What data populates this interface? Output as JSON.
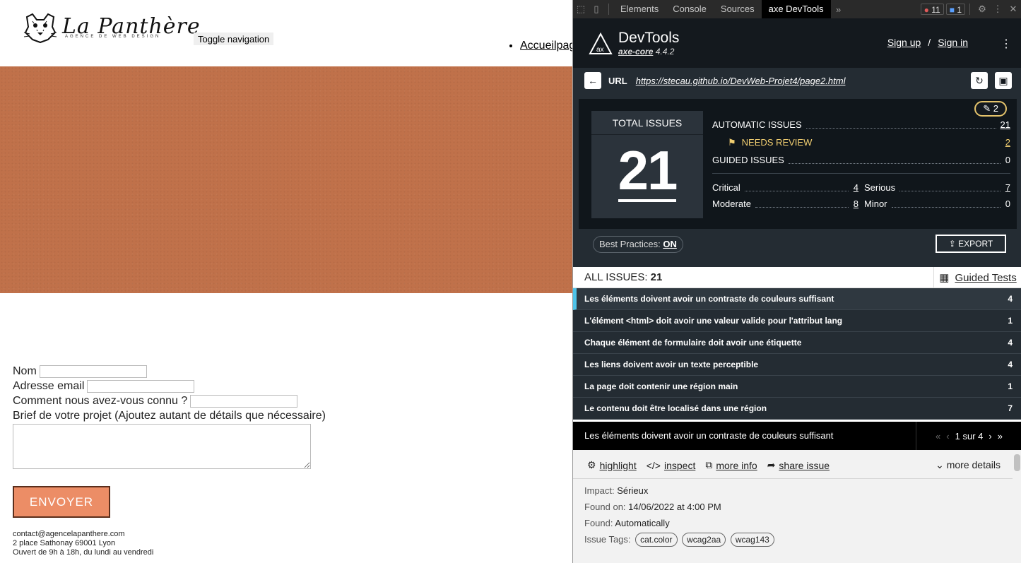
{
  "site": {
    "logo_title": "La Panthère",
    "logo_subtitle": "AGENCE DE WEB DESIGN",
    "toggle_nav": "Toggle navigation",
    "nav_item": "Accueilpag",
    "form": {
      "name_label": "Nom",
      "email_label": "Adresse email",
      "source_label": "Comment nous avez-vous connu ?",
      "brief_label": "Brief de votre projet (Ajoutez autant de détails que nécessaire)",
      "submit": "ENVOYER"
    },
    "footer": {
      "email": "contact@agencelapanthere.com",
      "address": "2 place Sathonay 69001 Lyon",
      "hours": "Ouvert de 9h à 18h, du lundi au vendredi"
    }
  },
  "devtools": {
    "tabs": [
      "Elements",
      "Console",
      "Sources",
      "axe DevTools"
    ],
    "more_tabs": "»",
    "error_count": "11",
    "message_count": "1",
    "axe": {
      "title": "DevTools",
      "core_name": "axe-core",
      "core_version": "4.4.2",
      "sign_up": "Sign up",
      "slash": "/",
      "sign_in": "Sign in",
      "url_label": "URL",
      "url": "https://stecau.github.io/DevWeb-Projet4/page2.html",
      "needs_review_badge": "2",
      "total_label": "TOTAL ISSUES",
      "total": "21",
      "automatic_label": "AUTOMATIC ISSUES",
      "automatic": "21",
      "needs_review_label": "NEEDS REVIEW",
      "needs_review": "2",
      "guided_label": "GUIDED ISSUES",
      "guided": "0",
      "critical_label": "Critical",
      "critical": "4",
      "serious_label": "Serious",
      "serious": "7",
      "moderate_label": "Moderate",
      "moderate": "8",
      "minor_label": "Minor",
      "minor": "0",
      "best_practices_label": "Best Practices:",
      "best_practices_value": "ON",
      "export": "EXPORT",
      "all_issues_label": "ALL ISSUES:",
      "all_issues_count": "21",
      "guided_tests": "Guided Tests",
      "issues": [
        {
          "name": "Les éléments doivent avoir un contraste de couleurs suffisant",
          "count": "4"
        },
        {
          "name": "L'élément <html> doit avoir une valeur valide pour l'attribut lang",
          "count": "1"
        },
        {
          "name": "Chaque élément de formulaire doit avoir une étiquette",
          "count": "4"
        },
        {
          "name": "Les liens doivent avoir un texte perceptible",
          "count": "4"
        },
        {
          "name": "La page doit contenir une région main",
          "count": "1"
        },
        {
          "name": "Le contenu doit être localisé dans une région",
          "count": "7"
        }
      ],
      "detail": {
        "title": "Les éléments doivent avoir un contraste de couleurs suffisant",
        "pager": "1 sur 4",
        "highlight": "highlight",
        "inspect": "inspect",
        "more_info": "more info",
        "share_issue": "share issue",
        "more_details": "more details",
        "impact_label": "Impact:",
        "impact": "Sérieux",
        "found_on_label": "Found on:",
        "found_on": "14/06/2022 at 4:00 PM",
        "found_label": "Found:",
        "found": "Automatically",
        "tags_label": "Issue Tags:",
        "tags": [
          "cat.color",
          "wcag2aa",
          "wcag143"
        ]
      }
    }
  }
}
